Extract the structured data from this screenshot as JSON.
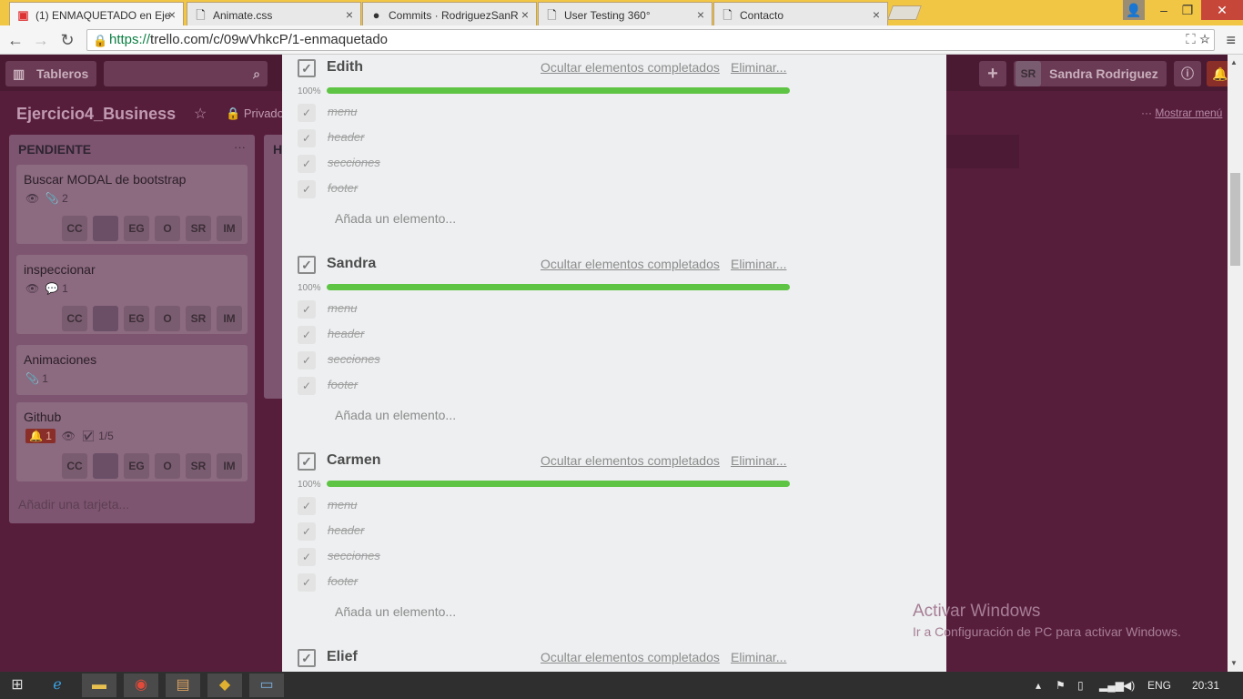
{
  "browser": {
    "tabs": [
      {
        "title": "(1) ENMAQUETADO en Eje",
        "icon": "trello-icon"
      },
      {
        "title": "Animate.css",
        "icon": "page-icon"
      },
      {
        "title": "Commits · RodriguezSanR",
        "icon": "github-icon"
      },
      {
        "title": "User Testing 360°",
        "icon": "page-icon"
      },
      {
        "title": "Contacto",
        "icon": "page-icon"
      }
    ],
    "url_scheme": "https://",
    "url_rest": "trello.com/c/09wVhkcP/1-enmaquetado"
  },
  "trello": {
    "boards_label": "Tableros",
    "user_initials": "SR",
    "user_name": "Sandra Rodriguez",
    "board_name": "Ejercicio4_Business",
    "privacy": "Privado",
    "show_menu": "Mostrar menú",
    "list": {
      "title": "PENDIENTE",
      "more": "···",
      "add_card": "Añadir una tarjeta...",
      "cards": [
        {
          "title": "Buscar MODAL de bootstrap",
          "badge1": "👁",
          "badge2": "📎 2",
          "members": [
            "CC",
            "",
            "EG",
            "O",
            "SR",
            "IM"
          ]
        },
        {
          "title": "inspeccionar",
          "badge1": "👁",
          "badge2": "💬 1",
          "members": [
            "CC",
            "",
            "EG",
            "O",
            "SR",
            "IM"
          ]
        },
        {
          "title": "Animaciones",
          "badge1": "📎 1",
          "badge2": "",
          "members": []
        },
        {
          "title": "Github",
          "badge1": "🔔 1",
          "badge2": "☑ 1/5",
          "members": [
            "CC",
            "",
            "EG",
            "O",
            "SR",
            "IM"
          ]
        }
      ]
    },
    "list2_initial": "H"
  },
  "modal": {
    "hide_label": "Ocultar elementos completados",
    "delete_label": "Eliminar...",
    "add_item": "Añada un elemento...",
    "checklists": [
      {
        "name": "Edith",
        "percent": "100%",
        "progress": 1.0,
        "items": [
          "menu",
          "header",
          "secciones",
          "footer"
        ]
      },
      {
        "name": "Sandra",
        "percent": "100%",
        "progress": 1.0,
        "items": [
          "menu",
          "header",
          "secciones",
          "footer"
        ]
      },
      {
        "name": "Carmen",
        "percent": "100%",
        "progress": 1.0,
        "items": [
          "menu",
          "header",
          "secciones",
          "footer"
        ]
      },
      {
        "name": "Elief",
        "percent": "",
        "progress": null,
        "items": []
      }
    ]
  },
  "watermark": {
    "line1": "Activar Windows",
    "line2": "Ir a Configuración de PC para activar Windows."
  },
  "taskbar": {
    "language": "ENG",
    "time": "20:31"
  },
  "colors": {
    "board": "#571e3c",
    "progress": "#5ec444",
    "tabstrip": "#f2c645"
  }
}
